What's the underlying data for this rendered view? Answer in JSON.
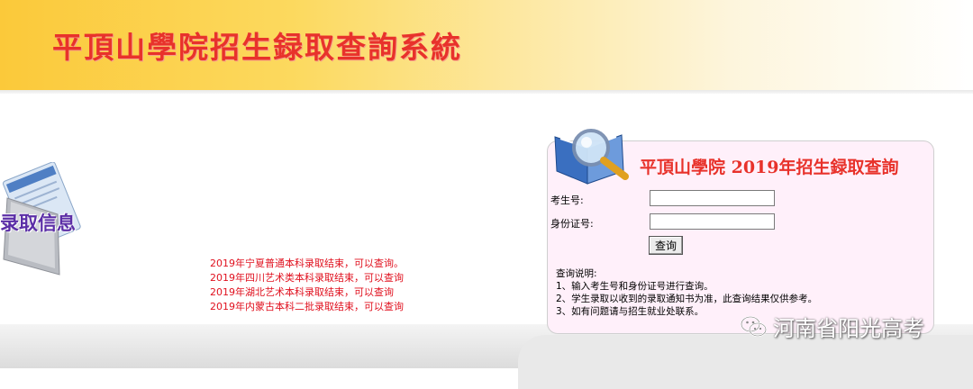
{
  "header": {
    "title": "平頂山學院招生録取查詢系統"
  },
  "sidebar": {
    "graphic_label": "录取信息"
  },
  "news": [
    "2019年宁夏普通本科录取结束，可以查询。",
    "2019年四川艺术类本科录取结束，可以查询",
    "2019年湖北艺术本科录取结束，可以查询",
    "2019年内蒙古本科二批录取结束，可以查询"
  ],
  "query_panel": {
    "title": "平頂山學院 2019年招生録取查詢",
    "exam_no_label": "考生号:",
    "exam_no_value": "",
    "id_no_label": "身份证号:",
    "id_no_value": "",
    "submit_label": "查询",
    "instructions_title": "查询说明:",
    "instructions": [
      "1、输入考生号和身份证号进行查询。",
      "2、学生录取以收到的录取通知书为准，此查询结果仅供参考。",
      "3、如有问题请与招生就业处联系。"
    ]
  },
  "watermark": {
    "text": "河南省阳光高考",
    "icon": "wechat-icon"
  },
  "colors": {
    "title_red": "#e8322b",
    "news_red": "#e0101e",
    "panel_bg": "#fff0fa",
    "banner_yellow": "#fbc93a",
    "label_purple": "#5b2ea6"
  }
}
